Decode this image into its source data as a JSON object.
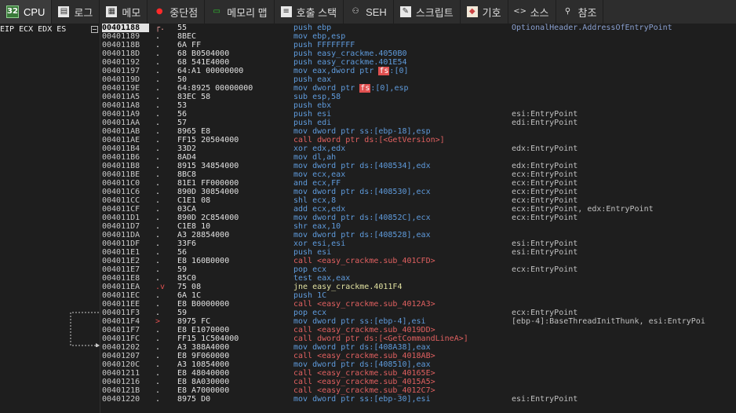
{
  "tabs": [
    {
      "label": "CPU",
      "icon": "cpu-icon",
      "active": true
    },
    {
      "label": "로그",
      "icon": "log-icon"
    },
    {
      "label": "메모",
      "icon": "notes-icon"
    },
    {
      "label": "중단점",
      "icon": "breakpoint-icon"
    },
    {
      "label": "메모리 맵",
      "icon": "memory-map-icon"
    },
    {
      "label": "호출 스택",
      "icon": "call-stack-icon"
    },
    {
      "label": "SEH",
      "icon": "seh-icon"
    },
    {
      "label": "스크립트",
      "icon": "script-icon"
    },
    {
      "label": "기호",
      "icon": "symbols-icon"
    },
    {
      "label": "소스",
      "icon": "source-icon"
    },
    {
      "label": "참조",
      "icon": "references-icon"
    }
  ],
  "registers": {
    "label": "EIP ECX EDX ES"
  },
  "disasm": [
    {
      "addr": "00401188",
      "mark": "┌.",
      "bytes": "55",
      "asm": "push ebp",
      "comment": "OptionalHeader.AddressOfEntryPoint",
      "kind": "cur"
    },
    {
      "addr": "00401189",
      "mark": ".",
      "bytes": "8BEC",
      "asm": "mov ebp,esp",
      "comment": ""
    },
    {
      "addr": "0040118B",
      "mark": ".",
      "bytes": "6A FF",
      "asm": "push FFFFFFFF",
      "comment": ""
    },
    {
      "addr": "0040118D",
      "mark": ".",
      "bytes": "68 B0504000",
      "asm": "push easy_crackme.4050B0",
      "comment": ""
    },
    {
      "addr": "00401192",
      "mark": ".",
      "bytes": "68 541E4000",
      "asm": "push easy_crackme.401E54",
      "comment": ""
    },
    {
      "addr": "00401197",
      "mark": ".",
      "bytes": "64:A1 00000000",
      "asm": "mov eax,dword ptr |fs|:[0]",
      "comment": ""
    },
    {
      "addr": "0040119D",
      "mark": ".",
      "bytes": "50",
      "asm": "push eax",
      "comment": ""
    },
    {
      "addr": "0040119E",
      "mark": ".",
      "bytes": "64:8925 00000000",
      "asm": "mov dword ptr |fs|:[0],esp",
      "comment": ""
    },
    {
      "addr": "004011A5",
      "mark": ".",
      "bytes": "83EC 58",
      "asm": "sub esp,58",
      "comment": ""
    },
    {
      "addr": "004011A8",
      "mark": ".",
      "bytes": "53",
      "asm": "push ebx",
      "comment": ""
    },
    {
      "addr": "004011A9",
      "mark": ".",
      "bytes": "56",
      "asm": "push esi",
      "comment": "esi:EntryPoint"
    },
    {
      "addr": "004011AA",
      "mark": ".",
      "bytes": "57",
      "asm": "push edi",
      "comment": "edi:EntryPoint"
    },
    {
      "addr": "004011AB",
      "mark": ".",
      "bytes": "8965 E8",
      "asm": "mov dword ptr ss:[ebp-18],esp",
      "comment": ""
    },
    {
      "addr": "004011AE",
      "mark": ".",
      "bytes": "FF15 20504000",
      "asm": "call dword ptr ds:[<GetVersion>]",
      "comment": "",
      "kind": "call"
    },
    {
      "addr": "004011B4",
      "mark": ".",
      "bytes": "33D2",
      "asm": "xor edx,edx",
      "comment": "edx:EntryPoint"
    },
    {
      "addr": "004011B6",
      "mark": ".",
      "bytes": "8AD4",
      "asm": "mov dl,ah",
      "comment": ""
    },
    {
      "addr": "004011B8",
      "mark": ".",
      "bytes": "8915 34854000",
      "asm": "mov dword ptr ds:[408534],edx",
      "comment": "edx:EntryPoint"
    },
    {
      "addr": "004011BE",
      "mark": ".",
      "bytes": "8BC8",
      "asm": "mov ecx,eax",
      "comment": "ecx:EntryPoint"
    },
    {
      "addr": "004011C0",
      "mark": ".",
      "bytes": "81E1 FF000000",
      "asm": "and ecx,FF",
      "comment": "ecx:EntryPoint"
    },
    {
      "addr": "004011C6",
      "mark": ".",
      "bytes": "890D 30854000",
      "asm": "mov dword ptr ds:[408530],ecx",
      "comment": "ecx:EntryPoint"
    },
    {
      "addr": "004011CC",
      "mark": ".",
      "bytes": "C1E1 08",
      "asm": "shl ecx,8",
      "comment": "ecx:EntryPoint"
    },
    {
      "addr": "004011CF",
      "mark": ".",
      "bytes": "03CA",
      "asm": "add ecx,edx",
      "comment": "ecx:EntryPoint, edx:EntryPoint"
    },
    {
      "addr": "004011D1",
      "mark": ".",
      "bytes": "890D 2C854000",
      "asm": "mov dword ptr ds:[40852C],ecx",
      "comment": "ecx:EntryPoint"
    },
    {
      "addr": "004011D7",
      "mark": ".",
      "bytes": "C1E8 10",
      "asm": "shr eax,10",
      "comment": ""
    },
    {
      "addr": "004011DA",
      "mark": ".",
      "bytes": "A3 28854000",
      "asm": "mov dword ptr ds:[408528],eax",
      "comment": ""
    },
    {
      "addr": "004011DF",
      "mark": ".",
      "bytes": "33F6",
      "asm": "xor esi,esi",
      "comment": "esi:EntryPoint"
    },
    {
      "addr": "004011E1",
      "mark": ".",
      "bytes": "56",
      "asm": "push esi",
      "comment": "esi:EntryPoint"
    },
    {
      "addr": "004011E2",
      "mark": ".",
      "bytes": "E8 160B0000",
      "asm": "call <easy_crackme.sub_401CFD>",
      "comment": "",
      "kind": "call"
    },
    {
      "addr": "004011E7",
      "mark": ".",
      "bytes": "59",
      "asm": "pop ecx",
      "comment": "ecx:EntryPoint"
    },
    {
      "addr": "004011E8",
      "mark": ".",
      "bytes": "85C0",
      "asm": "test eax,eax",
      "comment": ""
    },
    {
      "addr": "004011EA",
      "mark": ".v",
      "bytes": "75 08",
      "asm": "jne easy_crackme.4011F4",
      "comment": "",
      "kind": "jcc"
    },
    {
      "addr": "004011EC",
      "mark": ".",
      "bytes": "6A 1C",
      "asm": "push 1C",
      "comment": ""
    },
    {
      "addr": "004011EE",
      "mark": ".",
      "bytes": "E8 B0000000",
      "asm": "call <easy_crackme.sub_4012A3>",
      "comment": "",
      "kind": "call"
    },
    {
      "addr": "004011F3",
      "mark": ".",
      "bytes": "59",
      "asm": "pop ecx",
      "comment": "ecx:EntryPoint"
    },
    {
      "addr": "004011F4",
      "mark": ">",
      "bytes": "8975 FC",
      "asm": "mov dword ptr ss:[ebp-4],esi",
      "comment": "[ebp-4]:BaseThreadInitThunk, esi:EntryPoi",
      "kind": "jtgt"
    },
    {
      "addr": "004011F7",
      "mark": ".",
      "bytes": "E8 E1070000",
      "asm": "call <easy_crackme.sub_4019DD>",
      "comment": "",
      "kind": "call"
    },
    {
      "addr": "004011FC",
      "mark": ".",
      "bytes": "FF15 1C504000",
      "asm": "call dword ptr ds:[<GetCommandLineA>]",
      "comment": "",
      "kind": "call"
    },
    {
      "addr": "00401202",
      "mark": ".",
      "bytes": "A3 388A4000",
      "asm": "mov dword ptr ds:[408A38],eax",
      "comment": ""
    },
    {
      "addr": "00401207",
      "mark": ".",
      "bytes": "E8 9F060000",
      "asm": "call <easy_crackme.sub_4018AB>",
      "comment": "",
      "kind": "call"
    },
    {
      "addr": "0040120C",
      "mark": ".",
      "bytes": "A3 10854000",
      "asm": "mov dword ptr ds:[408510],eax",
      "comment": ""
    },
    {
      "addr": "00401211",
      "mark": ".",
      "bytes": "E8 48040000",
      "asm": "call <easy_crackme.sub_40165E>",
      "comment": "",
      "kind": "call"
    },
    {
      "addr": "00401216",
      "mark": ".",
      "bytes": "E8 8A030000",
      "asm": "call <easy_crackme.sub_4015A5>",
      "comment": "",
      "kind": "call"
    },
    {
      "addr": "0040121B",
      "mark": ".",
      "bytes": "E8 A7000000",
      "asm": "call <easy_crackme.sub_4012C7>",
      "comment": "",
      "kind": "call"
    },
    {
      "addr": "00401220",
      "mark": ".",
      "bytes": "8975 D0",
      "asm": "mov dword ptr ss:[ebp-30],esi",
      "comment": "esi:EntryPoint"
    }
  ]
}
